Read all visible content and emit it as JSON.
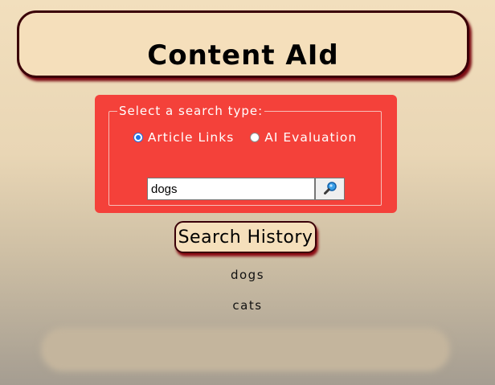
{
  "header": {
    "title": "Content AId"
  },
  "search": {
    "legend": "Select a search type:",
    "options": [
      {
        "label": "Article Links",
        "checked": true
      },
      {
        "label": "AI Evaluation",
        "checked": false
      }
    ],
    "query": "dogs",
    "button_icon": "magnifier-icon"
  },
  "history": {
    "button_label": "Search History",
    "items": [
      "dogs",
      "cats"
    ]
  },
  "colors": {
    "panel": "#f4413a",
    "header_bg": "#f5dfbb",
    "border": "#3a0008",
    "shadow": "#7a0a12",
    "radio_accent": "#1a73e8"
  }
}
